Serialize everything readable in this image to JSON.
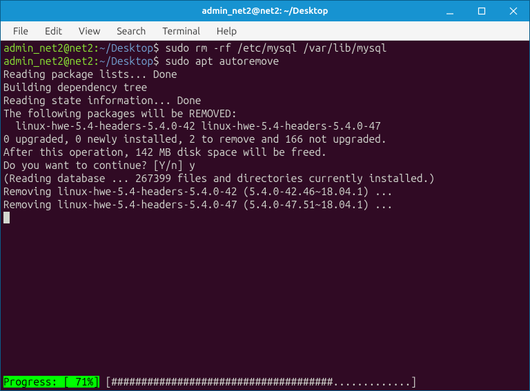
{
  "titlebar": {
    "title": "admin_net2@net2: ~/Desktop"
  },
  "menubar": {
    "items": [
      "File",
      "Edit",
      "View",
      "Search",
      "Terminal",
      "Help"
    ]
  },
  "prompt": {
    "user_host": "admin_net2@net2",
    "separator": ":",
    "path": "~/Desktop",
    "symbol": "$"
  },
  "commands": {
    "cmd1": "sudo rm -rf /etc/mysql /var/lib/mysql",
    "cmd2": "sudo apt autoremove"
  },
  "output": {
    "l1": "Reading package lists... Done",
    "l2": "Building dependency tree",
    "l3": "Reading state information... Done",
    "l4": "The following packages will be REMOVED:",
    "l5": "  linux-hwe-5.4-headers-5.4.0-42 linux-hwe-5.4-headers-5.4.0-47",
    "l6": "0 upgraded, 0 newly installed, 2 to remove and 166 not upgraded.",
    "l7": "After this operation, 142 MB disk space will be freed.",
    "l8": "Do you want to continue? [Y/n] y",
    "l9": "(Reading database ... 267399 files and directories currently installed.)",
    "l10": "Removing linux-hwe-5.4-headers-5.4.0-42 (5.4.0-42.46~18.04.1) ...",
    "l11": "Removing linux-hwe-5.4-headers-5.4.0-47 (5.4.0-47.51~18.04.1) ..."
  },
  "progress": {
    "label": "Progress: [ 71%]",
    "bar": " [#####################################.............] "
  }
}
